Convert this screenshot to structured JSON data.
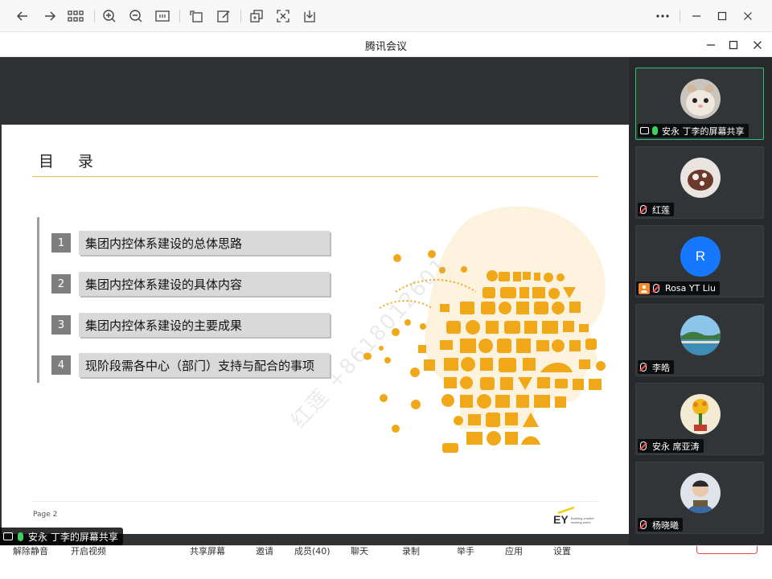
{
  "toolbar": {
    "icons": [
      "back-arrow-icon",
      "forward-arrow-icon",
      "grid-icon",
      "zoom-in-icon",
      "zoom-out-icon",
      "fit-width-icon",
      "rotate-icon",
      "edit-icon",
      "copy-icon",
      "shrink-icon",
      "download-icon",
      "more-icon",
      "minimize-icon",
      "maximize-icon",
      "close-icon"
    ]
  },
  "window": {
    "title": "腾讯会议"
  },
  "slide": {
    "heading": "目 录",
    "items": [
      {
        "num": "1",
        "label": "集团内控体系建设的总体思路"
      },
      {
        "num": "2",
        "label": "集团内控体系建设的具体内容"
      },
      {
        "num": "3",
        "label": "集团内控体系建设的主要成果"
      },
      {
        "num": "4",
        "label": "现阶段需各中心（部门）支持与配合的事项"
      }
    ],
    "page": "Page 2",
    "logo_text": "EY",
    "logo_tagline_1": "Building a better",
    "logo_tagline_2": "working world",
    "watermark": "红莲 +8618012601",
    "accent_color": "#f0a818"
  },
  "presenter_badge": {
    "label": "安永 丁李的屏幕共享"
  },
  "participants": [
    {
      "name": "安永 丁李的屏幕共享",
      "type": "share",
      "avatar": "hamster"
    },
    {
      "name": "红莲",
      "type": "muted",
      "avatar": "cake"
    },
    {
      "name": "Rosa YT Liu",
      "type": "muted",
      "avatar": "letter",
      "letter": "R",
      "color": "#1677ff"
    },
    {
      "name": "李皓",
      "type": "muted",
      "avatar": "landscape"
    },
    {
      "name": "安永 席亚涛",
      "type": "muted",
      "avatar": "flowers"
    },
    {
      "name": "杨晓曦",
      "type": "muted",
      "avatar": "child"
    }
  ],
  "bottom_bar": {
    "items": [
      "解除静音",
      "开启视频",
      "共享屏幕",
      "邀请",
      "成员(40)",
      "聊天",
      "录制",
      "举手",
      "应用",
      "设置"
    ]
  }
}
